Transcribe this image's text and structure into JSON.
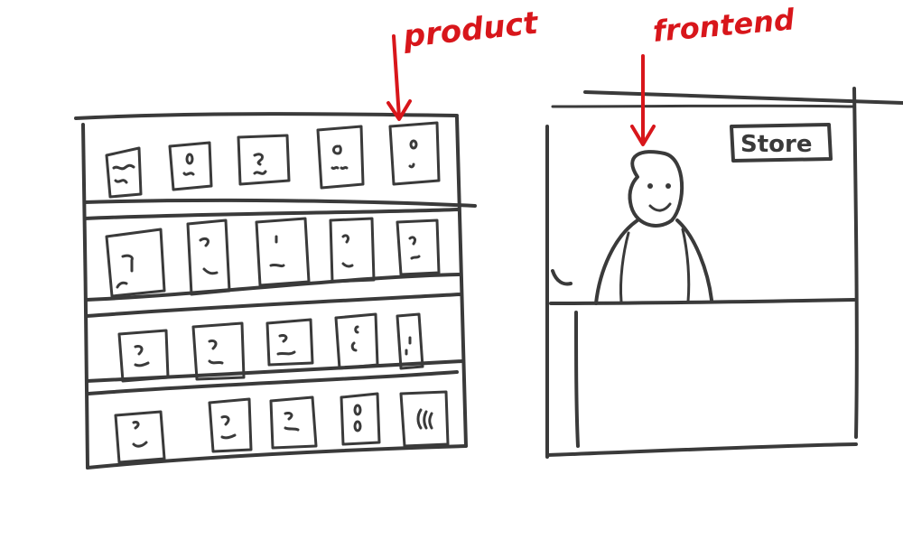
{
  "annotations": {
    "product_label": "product",
    "frontend_label": "frontend"
  },
  "store": {
    "sign_text": "Store"
  },
  "colors": {
    "annotation": "#d8161b",
    "ink": "#3a3a3a",
    "background": "#ffffff"
  },
  "shelf": {
    "rows": 4,
    "items_per_row": 5
  }
}
